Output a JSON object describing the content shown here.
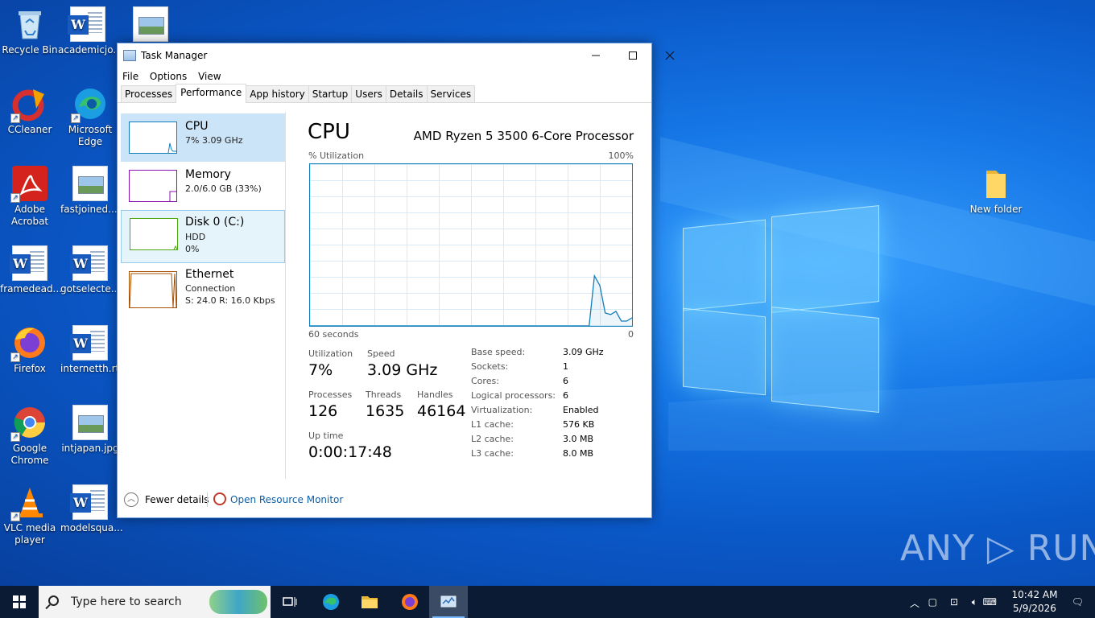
{
  "desktop": {
    "icons": [
      {
        "label": "Recycle Bin"
      },
      {
        "label": "academicjo..."
      },
      {
        "label": ""
      },
      {
        "label": "CCleaner"
      },
      {
        "label": "Microsoft Edge"
      },
      {
        "label": "Adobe Acrobat"
      },
      {
        "label": "fastjoined...."
      },
      {
        "label": "framedead..."
      },
      {
        "label": "gotselecte..."
      },
      {
        "label": "Firefox"
      },
      {
        "label": "internetth.rtf"
      },
      {
        "label": "Google Chrome"
      },
      {
        "label": "intjapan.jpg"
      },
      {
        "label": "VLC media player"
      },
      {
        "label": "modelsqua..."
      },
      {
        "label": "New folder"
      }
    ],
    "watermark": "ANY ▷ RUN"
  },
  "task_manager": {
    "title": "Task Manager",
    "menu": [
      "File",
      "Options",
      "View"
    ],
    "tabs": [
      "Processes",
      "Performance",
      "App history",
      "Startup",
      "Users",
      "Details",
      "Services"
    ],
    "active_tab": "Performance",
    "resources": [
      {
        "name": "CPU",
        "line1": "7%  3.09 GHz",
        "line2": "",
        "color": "#117dbb"
      },
      {
        "name": "Memory",
        "line1": "2.0/6.0 GB (33%)",
        "line2": "",
        "color": "#8b12ae"
      },
      {
        "name": "Disk 0 (C:)",
        "line1": "HDD",
        "line2": "0%",
        "color": "#4da60c"
      },
      {
        "name": "Ethernet",
        "line1": "Connection",
        "line2": "S: 24.0  R: 16.0 Kbps",
        "color": "#a74f01"
      }
    ],
    "detail": {
      "heading": "CPU",
      "model": "AMD Ryzen 5 3500 6-Core Processor",
      "util_label": "% Utilization",
      "util_max": "100%",
      "time_label": "60 seconds",
      "zero_label": "0",
      "stats": {
        "utilization_label": "Utilization",
        "utilization": "7%",
        "speed_label": "Speed",
        "speed": "3.09 GHz",
        "processes_label": "Processes",
        "processes": "126",
        "threads_label": "Threads",
        "threads": "1635",
        "handles_label": "Handles",
        "handles": "46164",
        "uptime_label": "Up time",
        "uptime": "0:00:17:48"
      },
      "specs": [
        {
          "k": "Base speed:",
          "v": "3.09 GHz"
        },
        {
          "k": "Sockets:",
          "v": "1"
        },
        {
          "k": "Cores:",
          "v": "6"
        },
        {
          "k": "Logical processors:",
          "v": "6"
        },
        {
          "k": "Virtualization:",
          "v": "Enabled"
        },
        {
          "k": "L1 cache:",
          "v": "576 KB"
        },
        {
          "k": "L2 cache:",
          "v": "3.0 MB"
        },
        {
          "k": "L3 cache:",
          "v": "8.0 MB"
        }
      ],
      "graph_series_percent": [
        0,
        0,
        0,
        0,
        0,
        0,
        0,
        0,
        0,
        0,
        0,
        0,
        0,
        0,
        0,
        0,
        0,
        0,
        0,
        0,
        0,
        0,
        0,
        0,
        0,
        0,
        0,
        0,
        0,
        0,
        0,
        0,
        0,
        0,
        0,
        0,
        0,
        0,
        0,
        0,
        0,
        0,
        0,
        0,
        0,
        0,
        0,
        0,
        0,
        0,
        0,
        0,
        0,
        31,
        25,
        8,
        7,
        9,
        3,
        3,
        5
      ]
    },
    "footer": {
      "fewer": "Fewer details",
      "resource_monitor": "Open Resource Monitor"
    }
  },
  "taskbar": {
    "search_placeholder": "Type here to search",
    "time": "10:42 AM",
    "date": "5/9/2026"
  }
}
